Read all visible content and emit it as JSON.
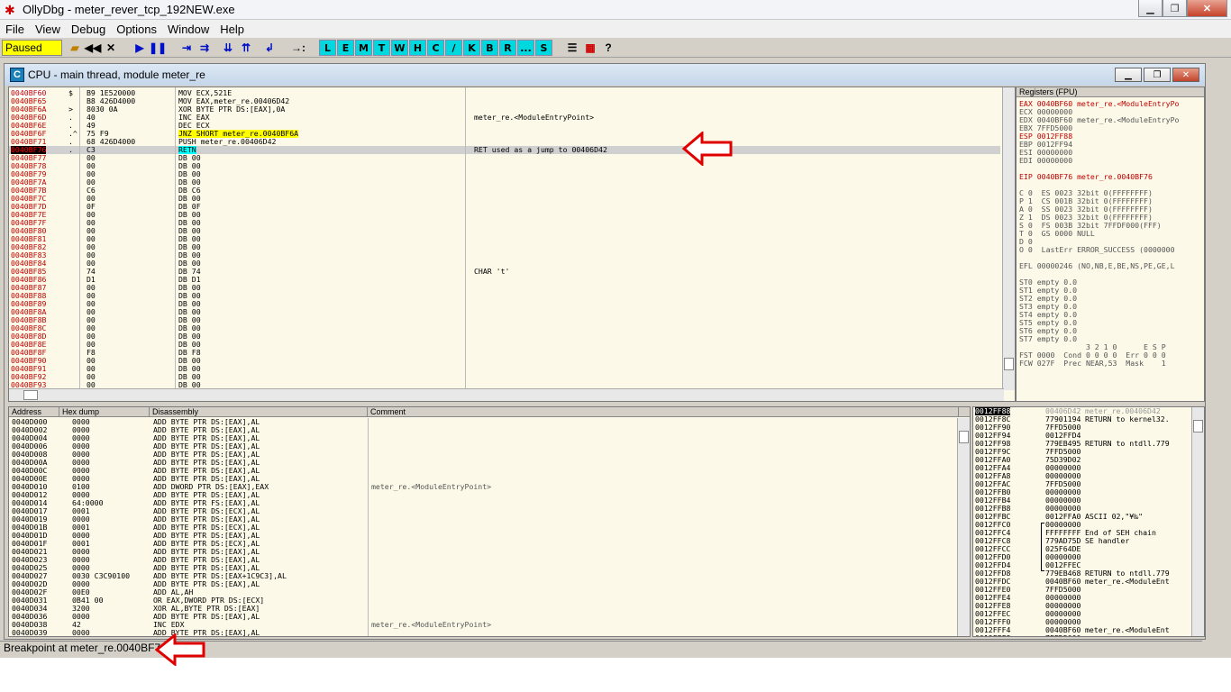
{
  "window": {
    "title": "OllyDbg - meter_rever_tcp_192NEW.exe"
  },
  "menu": [
    "File",
    "View",
    "Debug",
    "Options",
    "Window",
    "Help"
  ],
  "toolbar": {
    "status": "Paused",
    "buttons": [
      "▶",
      "❚❚",
      "⇥",
      "⇉",
      "⇊",
      "⇈",
      "↲",
      "→:"
    ],
    "letters": [
      "L",
      "E",
      "M",
      "T",
      "W",
      "H",
      "C",
      "/",
      "K",
      "B",
      "R",
      "...",
      "S"
    ]
  },
  "cpu": {
    "title": "CPU - main thread, module meter_re",
    "disasm": [
      {
        "a": "0040BF60",
        "m": "$",
        "h": "B9 1E520000",
        "d": "MOV ECX,521E",
        "c": ""
      },
      {
        "a": "0040BF65",
        "m": "",
        "h": "B8 426D4000",
        "d": "MOV EAX,meter_re.00406D42",
        "c": ""
      },
      {
        "a": "0040BF6A",
        "m": ">",
        "h": "8030 0A",
        "d": "XOR BYTE PTR DS:[EAX],0A",
        "c": ""
      },
      {
        "a": "0040BF6D",
        "m": ".",
        "h": "40",
        "d": "INC EAX",
        "c": "meter_re.<ModuleEntryPoint>"
      },
      {
        "a": "0040BF6E",
        "m": ".",
        "h": "49",
        "d": "DEC ECX",
        "c": ""
      },
      {
        "a": "0040BF6F",
        "m": ".^",
        "h": "75 F9",
        "d": "JNZ SHORT meter_re.0040BF6A",
        "c": ""
      },
      {
        "a": "0040BF71",
        "m": ".",
        "h": "68 426D4000",
        "d": "PUSH meter_re.00406D42",
        "c": ""
      },
      {
        "a": "0040BF76",
        "m": ".",
        "h": "C3",
        "d": "RETN",
        "c": "RET used as a jump to 00406D42"
      },
      {
        "a": "0040BF77",
        "m": "",
        "h": "00",
        "d": "DB 00",
        "c": ""
      },
      {
        "a": "0040BF78",
        "m": "",
        "h": "00",
        "d": "DB 00",
        "c": ""
      },
      {
        "a": "0040BF79",
        "m": "",
        "h": "00",
        "d": "DB 00",
        "c": ""
      },
      {
        "a": "0040BF7A",
        "m": "",
        "h": "00",
        "d": "DB 00",
        "c": ""
      },
      {
        "a": "0040BF7B",
        "m": "",
        "h": "C6",
        "d": "DB C6",
        "c": ""
      },
      {
        "a": "0040BF7C",
        "m": "",
        "h": "00",
        "d": "DB 00",
        "c": ""
      },
      {
        "a": "0040BF7D",
        "m": "",
        "h": "0F",
        "d": "DB 0F",
        "c": ""
      },
      {
        "a": "0040BF7E",
        "m": "",
        "h": "00",
        "d": "DB 00",
        "c": ""
      },
      {
        "a": "0040BF7F",
        "m": "",
        "h": "00",
        "d": "DB 00",
        "c": ""
      },
      {
        "a": "0040BF80",
        "m": "",
        "h": "00",
        "d": "DB 00",
        "c": ""
      },
      {
        "a": "0040BF81",
        "m": "",
        "h": "00",
        "d": "DB 00",
        "c": ""
      },
      {
        "a": "0040BF82",
        "m": "",
        "h": "00",
        "d": "DB 00",
        "c": ""
      },
      {
        "a": "0040BF83",
        "m": "",
        "h": "00",
        "d": "DB 00",
        "c": ""
      },
      {
        "a": "0040BF84",
        "m": "",
        "h": "00",
        "d": "DB 00",
        "c": ""
      },
      {
        "a": "0040BF85",
        "m": "",
        "h": "74",
        "d": "DB 74",
        "c": "CHAR 't'"
      },
      {
        "a": "0040BF86",
        "m": "",
        "h": "D1",
        "d": "DB D1",
        "c": ""
      },
      {
        "a": "0040BF87",
        "m": "",
        "h": "00",
        "d": "DB 00",
        "c": ""
      },
      {
        "a": "0040BF88",
        "m": "",
        "h": "00",
        "d": "DB 00",
        "c": ""
      },
      {
        "a": "0040BF89",
        "m": "",
        "h": "00",
        "d": "DB 00",
        "c": ""
      },
      {
        "a": "0040BF8A",
        "m": "",
        "h": "00",
        "d": "DB 00",
        "c": ""
      },
      {
        "a": "0040BF8B",
        "m": "",
        "h": "00",
        "d": "DB 00",
        "c": ""
      },
      {
        "a": "0040BF8C",
        "m": "",
        "h": "00",
        "d": "DB 00",
        "c": ""
      },
      {
        "a": "0040BF8D",
        "m": "",
        "h": "00",
        "d": "DB 00",
        "c": ""
      },
      {
        "a": "0040BF8E",
        "m": "",
        "h": "00",
        "d": "DB 00",
        "c": ""
      },
      {
        "a": "0040BF8F",
        "m": "",
        "h": "F8",
        "d": "DB F8",
        "c": ""
      },
      {
        "a": "0040BF90",
        "m": "",
        "h": "00",
        "d": "DB 00",
        "c": ""
      },
      {
        "a": "0040BF91",
        "m": "",
        "h": "00",
        "d": "DB 00",
        "c": ""
      },
      {
        "a": "0040BF92",
        "m": "",
        "h": "00",
        "d": "DB 00",
        "c": ""
      },
      {
        "a": "0040BF93",
        "m": "",
        "h": "00",
        "d": "DB 00",
        "c": ""
      }
    ],
    "registers": {
      "header": "Registers (FPU)",
      "lines": [
        "EAX 0040BF60 meter_re.<ModuleEntryPo",
        "ECX 00000000",
        "EDX 0040BF60 meter_re.<ModuleEntryPo",
        "EBX 7FFD5000",
        "ESP 0012FF88",
        "EBP 0012FF94",
        "ESI 00000000",
        "EDI 00000000",
        "",
        "EIP 0040BF76 meter_re.0040BF76",
        "",
        "C 0  ES 0023 32bit 0(FFFFFFFF)",
        "P 1  CS 001B 32bit 0(FFFFFFFF)",
        "A 0  SS 0023 32bit 0(FFFFFFFF)",
        "Z 1  DS 0023 32bit 0(FFFFFFFF)",
        "S 0  FS 003B 32bit 7FFDF000(FFF)",
        "T 0  GS 0000 NULL",
        "D 0",
        "O 0  LastErr ERROR_SUCCESS (0000000",
        "",
        "EFL 00000246 (NO,NB,E,BE,NS,PE,GE,L",
        "",
        "ST0 empty 0.0",
        "ST1 empty 0.0",
        "ST2 empty 0.0",
        "ST3 empty 0.0",
        "ST4 empty 0.0",
        "ST5 empty 0.0",
        "ST6 empty 0.0",
        "ST7 empty 0.0",
        "               3 2 1 0      E S P",
        "FST 0000  Cond 0 0 0 0  Err 0 0 0",
        "FCW 027F  Prec NEAR,53  Mask    1"
      ]
    },
    "dump": {
      "headers": [
        "Address",
        "Hex dump",
        "Disassembly",
        "Comment"
      ],
      "rows": [
        {
          "a": "0040D000",
          "h": "0000",
          "d": "ADD BYTE PTR DS:[EAX],AL",
          "c": ""
        },
        {
          "a": "0040D002",
          "h": "0000",
          "d": "ADD BYTE PTR DS:[EAX],AL",
          "c": ""
        },
        {
          "a": "0040D004",
          "h": "0000",
          "d": "ADD BYTE PTR DS:[EAX],AL",
          "c": ""
        },
        {
          "a": "0040D006",
          "h": "0000",
          "d": "ADD BYTE PTR DS:[EAX],AL",
          "c": ""
        },
        {
          "a": "0040D008",
          "h": "0000",
          "d": "ADD BYTE PTR DS:[EAX],AL",
          "c": ""
        },
        {
          "a": "0040D00A",
          "h": "0000",
          "d": "ADD BYTE PTR DS:[EAX],AL",
          "c": ""
        },
        {
          "a": "0040D00C",
          "h": "0000",
          "d": "ADD BYTE PTR DS:[EAX],AL",
          "c": ""
        },
        {
          "a": "0040D00E",
          "h": "0000",
          "d": "ADD BYTE PTR DS:[EAX],AL",
          "c": ""
        },
        {
          "a": "0040D010",
          "h": "0100",
          "d": "ADD DWORD PTR DS:[EAX],EAX",
          "c": "meter_re.<ModuleEntryPoint>"
        },
        {
          "a": "0040D012",
          "h": "0000",
          "d": "ADD BYTE PTR DS:[EAX],AL",
          "c": ""
        },
        {
          "a": "0040D014",
          "h": "64:0000",
          "d": "ADD BYTE PTR FS:[EAX],AL",
          "c": ""
        },
        {
          "a": "0040D017",
          "h": "0001",
          "d": "ADD BYTE PTR DS:[ECX],AL",
          "c": ""
        },
        {
          "a": "0040D019",
          "h": "0000",
          "d": "ADD BYTE PTR DS:[EAX],AL",
          "c": ""
        },
        {
          "a": "0040D01B",
          "h": "0001",
          "d": "ADD BYTE PTR DS:[ECX],AL",
          "c": ""
        },
        {
          "a": "0040D01D",
          "h": "0000",
          "d": "ADD BYTE PTR DS:[EAX],AL",
          "c": ""
        },
        {
          "a": "0040D01F",
          "h": "0001",
          "d": "ADD BYTE PTR DS:[ECX],AL",
          "c": ""
        },
        {
          "a": "0040D021",
          "h": "0000",
          "d": "ADD BYTE PTR DS:[EAX],AL",
          "c": ""
        },
        {
          "a": "0040D023",
          "h": "0000",
          "d": "ADD BYTE PTR DS:[EAX],AL",
          "c": ""
        },
        {
          "a": "0040D025",
          "h": "0000",
          "d": "ADD BYTE PTR DS:[EAX],AL",
          "c": ""
        },
        {
          "a": "0040D027",
          "h": "0030 C3C90100",
          "d": "ADD BYTE PTR DS:[EAX+1C9C3],AL",
          "c": ""
        },
        {
          "a": "0040D02D",
          "h": "0000",
          "d": "ADD BYTE PTR DS:[EAX],AL",
          "c": ""
        },
        {
          "a": "0040D02F",
          "h": "00E0",
          "d": "ADD AL,AH",
          "c": ""
        },
        {
          "a": "0040D031",
          "h": "0B41 00",
          "d": "OR EAX,DWORD PTR DS:[ECX]",
          "c": ""
        },
        {
          "a": "0040D034",
          "h": "3200",
          "d": "XOR AL,BYTE PTR DS:[EAX]",
          "c": ""
        },
        {
          "a": "0040D036",
          "h": "0000",
          "d": "ADD BYTE PTR DS:[EAX],AL",
          "c": ""
        },
        {
          "a": "0040D038",
          "h": "42",
          "d": "INC EDX",
          "c": "meter_re.<ModuleEntryPoint>"
        },
        {
          "a": "0040D039",
          "h": "0000",
          "d": "ADD BYTE PTR DS:[EAX],AL",
          "c": ""
        }
      ]
    },
    "stack": [
      {
        "a": "0012FF88",
        "v": "00406D42",
        "c": "meter_re.00406D42"
      },
      {
        "a": "0012FF8C",
        "v": "77901194",
        "c": "RETURN to kernel32."
      },
      {
        "a": "0012FF90",
        "v": "7FFD5000",
        "c": ""
      },
      {
        "a": "0012FF94",
        "v": "0012FFD4",
        "c": ""
      },
      {
        "a": "0012FF98",
        "v": "779EB495",
        "c": "RETURN to ntdll.779"
      },
      {
        "a": "0012FF9C",
        "v": "7FFD5000",
        "c": ""
      },
      {
        "a": "0012FFA0",
        "v": "75D39D02",
        "c": ""
      },
      {
        "a": "0012FFA4",
        "v": "00000000",
        "c": ""
      },
      {
        "a": "0012FFA8",
        "v": "00000000",
        "c": ""
      },
      {
        "a": "0012FFAC",
        "v": "7FFD5000",
        "c": ""
      },
      {
        "a": "0012FFB0",
        "v": "00000000",
        "c": ""
      },
      {
        "a": "0012FFB4",
        "v": "00000000",
        "c": ""
      },
      {
        "a": "0012FFB8",
        "v": "00000000",
        "c": ""
      },
      {
        "a": "0012FFBC",
        "v": "0012FFA0",
        "c": "ASCII 02,\"¥‰\""
      },
      {
        "a": "0012FFC0",
        "v": "00000000",
        "c": ""
      },
      {
        "a": "0012FFC4",
        "v": "FFFFFFFF",
        "c": "End of SEH chain"
      },
      {
        "a": "0012FFC8",
        "v": "779AD75D",
        "c": "SE handler"
      },
      {
        "a": "0012FFCC",
        "v": "025F64DE",
        "c": ""
      },
      {
        "a": "0012FFD0",
        "v": "00000000",
        "c": ""
      },
      {
        "a": "0012FFD4",
        "v": "0012FFEC",
        "c": ""
      },
      {
        "a": "0012FFD8",
        "v": "779EB468",
        "c": "RETURN to ntdll.779"
      },
      {
        "a": "0012FFDC",
        "v": "0040BF60",
        "c": "meter_re.<ModuleEnt"
      },
      {
        "a": "0012FFE0",
        "v": "7FFD5000",
        "c": ""
      },
      {
        "a": "0012FFE4",
        "v": "00000000",
        "c": ""
      },
      {
        "a": "0012FFE8",
        "v": "00000000",
        "c": ""
      },
      {
        "a": "0012FFEC",
        "v": "00000000",
        "c": ""
      },
      {
        "a": "0012FFF0",
        "v": "00000000",
        "c": ""
      },
      {
        "a": "0012FFF4",
        "v": "0040BF60",
        "c": "meter_re.<ModuleEnt"
      },
      {
        "a": "0012FFF8",
        "v": "7FFD5000",
        "c": ""
      }
    ]
  },
  "status": {
    "message": "Breakpoint at meter_re.0040BF76"
  },
  "colors": {
    "accent": "#ffff00",
    "arrow": "#e00000",
    "pane_bg": "#fcf9e8"
  }
}
